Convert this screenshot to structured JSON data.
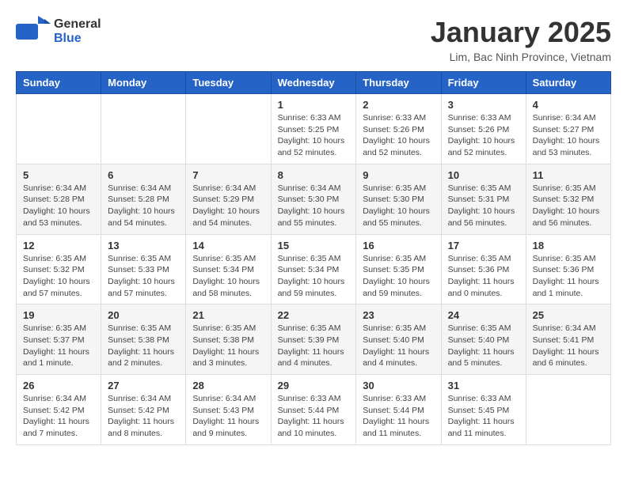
{
  "logo": {
    "general": "General",
    "blue": "Blue"
  },
  "title": "January 2025",
  "location": "Lim, Bac Ninh Province, Vietnam",
  "days_of_week": [
    "Sunday",
    "Monday",
    "Tuesday",
    "Wednesday",
    "Thursday",
    "Friday",
    "Saturday"
  ],
  "weeks": [
    [
      {
        "day": "",
        "info": ""
      },
      {
        "day": "",
        "info": ""
      },
      {
        "day": "",
        "info": ""
      },
      {
        "day": "1",
        "info": "Sunrise: 6:33 AM\nSunset: 5:25 PM\nDaylight: 10 hours\nand 52 minutes."
      },
      {
        "day": "2",
        "info": "Sunrise: 6:33 AM\nSunset: 5:26 PM\nDaylight: 10 hours\nand 52 minutes."
      },
      {
        "day": "3",
        "info": "Sunrise: 6:33 AM\nSunset: 5:26 PM\nDaylight: 10 hours\nand 52 minutes."
      },
      {
        "day": "4",
        "info": "Sunrise: 6:34 AM\nSunset: 5:27 PM\nDaylight: 10 hours\nand 53 minutes."
      }
    ],
    [
      {
        "day": "5",
        "info": "Sunrise: 6:34 AM\nSunset: 5:28 PM\nDaylight: 10 hours\nand 53 minutes."
      },
      {
        "day": "6",
        "info": "Sunrise: 6:34 AM\nSunset: 5:28 PM\nDaylight: 10 hours\nand 54 minutes."
      },
      {
        "day": "7",
        "info": "Sunrise: 6:34 AM\nSunset: 5:29 PM\nDaylight: 10 hours\nand 54 minutes."
      },
      {
        "day": "8",
        "info": "Sunrise: 6:34 AM\nSunset: 5:30 PM\nDaylight: 10 hours\nand 55 minutes."
      },
      {
        "day": "9",
        "info": "Sunrise: 6:35 AM\nSunset: 5:30 PM\nDaylight: 10 hours\nand 55 minutes."
      },
      {
        "day": "10",
        "info": "Sunrise: 6:35 AM\nSunset: 5:31 PM\nDaylight: 10 hours\nand 56 minutes."
      },
      {
        "day": "11",
        "info": "Sunrise: 6:35 AM\nSunset: 5:32 PM\nDaylight: 10 hours\nand 56 minutes."
      }
    ],
    [
      {
        "day": "12",
        "info": "Sunrise: 6:35 AM\nSunset: 5:32 PM\nDaylight: 10 hours\nand 57 minutes."
      },
      {
        "day": "13",
        "info": "Sunrise: 6:35 AM\nSunset: 5:33 PM\nDaylight: 10 hours\nand 57 minutes."
      },
      {
        "day": "14",
        "info": "Sunrise: 6:35 AM\nSunset: 5:34 PM\nDaylight: 10 hours\nand 58 minutes."
      },
      {
        "day": "15",
        "info": "Sunrise: 6:35 AM\nSunset: 5:34 PM\nDaylight: 10 hours\nand 59 minutes."
      },
      {
        "day": "16",
        "info": "Sunrise: 6:35 AM\nSunset: 5:35 PM\nDaylight: 10 hours\nand 59 minutes."
      },
      {
        "day": "17",
        "info": "Sunrise: 6:35 AM\nSunset: 5:36 PM\nDaylight: 11 hours\nand 0 minutes."
      },
      {
        "day": "18",
        "info": "Sunrise: 6:35 AM\nSunset: 5:36 PM\nDaylight: 11 hours\nand 1 minute."
      }
    ],
    [
      {
        "day": "19",
        "info": "Sunrise: 6:35 AM\nSunset: 5:37 PM\nDaylight: 11 hours\nand 1 minute."
      },
      {
        "day": "20",
        "info": "Sunrise: 6:35 AM\nSunset: 5:38 PM\nDaylight: 11 hours\nand 2 minutes."
      },
      {
        "day": "21",
        "info": "Sunrise: 6:35 AM\nSunset: 5:38 PM\nDaylight: 11 hours\nand 3 minutes."
      },
      {
        "day": "22",
        "info": "Sunrise: 6:35 AM\nSunset: 5:39 PM\nDaylight: 11 hours\nand 4 minutes."
      },
      {
        "day": "23",
        "info": "Sunrise: 6:35 AM\nSunset: 5:40 PM\nDaylight: 11 hours\nand 4 minutes."
      },
      {
        "day": "24",
        "info": "Sunrise: 6:35 AM\nSunset: 5:40 PM\nDaylight: 11 hours\nand 5 minutes."
      },
      {
        "day": "25",
        "info": "Sunrise: 6:34 AM\nSunset: 5:41 PM\nDaylight: 11 hours\nand 6 minutes."
      }
    ],
    [
      {
        "day": "26",
        "info": "Sunrise: 6:34 AM\nSunset: 5:42 PM\nDaylight: 11 hours\nand 7 minutes."
      },
      {
        "day": "27",
        "info": "Sunrise: 6:34 AM\nSunset: 5:42 PM\nDaylight: 11 hours\nand 8 minutes."
      },
      {
        "day": "28",
        "info": "Sunrise: 6:34 AM\nSunset: 5:43 PM\nDaylight: 11 hours\nand 9 minutes."
      },
      {
        "day": "29",
        "info": "Sunrise: 6:33 AM\nSunset: 5:44 PM\nDaylight: 11 hours\nand 10 minutes."
      },
      {
        "day": "30",
        "info": "Sunrise: 6:33 AM\nSunset: 5:44 PM\nDaylight: 11 hours\nand 11 minutes."
      },
      {
        "day": "31",
        "info": "Sunrise: 6:33 AM\nSunset: 5:45 PM\nDaylight: 11 hours\nand 11 minutes."
      },
      {
        "day": "",
        "info": ""
      }
    ]
  ]
}
